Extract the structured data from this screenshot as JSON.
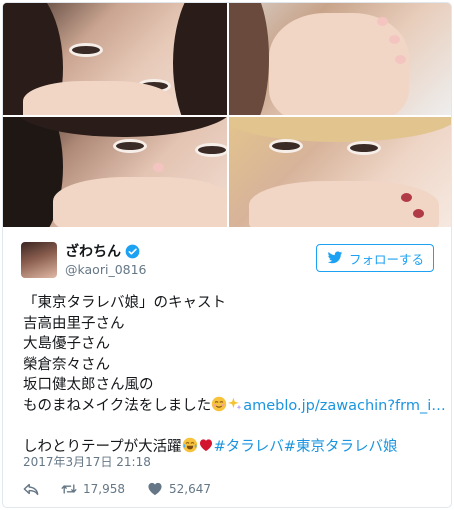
{
  "profile": {
    "display_name": "ざわちん",
    "handle": "@kaori_0816",
    "verified": true
  },
  "follow_button": {
    "label": "フォローする"
  },
  "tweet": {
    "lines": [
      "「東京タラレバ娘」のキャスト",
      "吉高由里子さん",
      "大島優子さん",
      "榮倉奈々さん",
      "坂口健太郎さん風の",
      "ものまねメイク法をしました"
    ],
    "link_text": "ameblo.jp/zawachin?frm_i…",
    "last_line_text": "しわとりテープが大活躍",
    "hashtags": [
      "#タラレバ",
      "#東京タラレバ娘"
    ]
  },
  "timestamp": "2017年3月17日 21:18",
  "actions": {
    "retweets": "17,958",
    "likes": "52,647"
  },
  "icons": {
    "reply": "reply-icon",
    "retweet": "retweet-icon",
    "like": "heart-icon",
    "verified": "verified-badge-icon",
    "twitter": "twitter-bird-icon"
  },
  "colors": {
    "accent": "#1da1f2",
    "link": "#1b95e0",
    "muted": "#657786",
    "heart": "#c4122f"
  }
}
